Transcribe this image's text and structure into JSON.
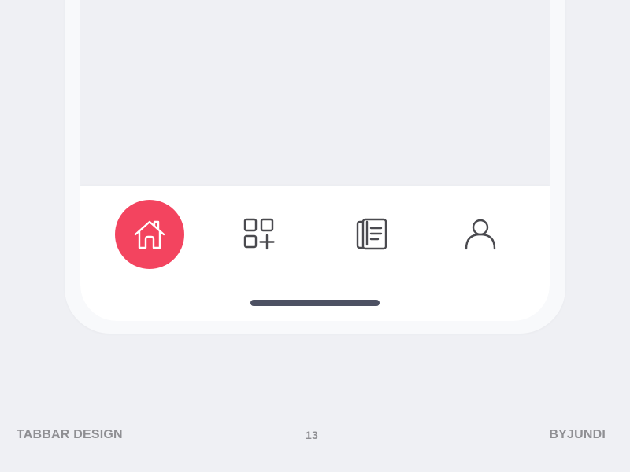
{
  "tabbar": {
    "tabs": [
      {
        "name": "home",
        "icon": "home-icon",
        "active": true
      },
      {
        "name": "apps",
        "icon": "add-grid-icon",
        "active": false
      },
      {
        "name": "documents",
        "icon": "documents-icon",
        "active": false
      },
      {
        "name": "profile",
        "icon": "user-icon",
        "active": false
      }
    ],
    "active_color": "#f3445f",
    "icon_color": "#4a4a4f"
  },
  "footer": {
    "left": "TABBAR DESIGN",
    "center": "13",
    "right": "BYJUNDI"
  }
}
